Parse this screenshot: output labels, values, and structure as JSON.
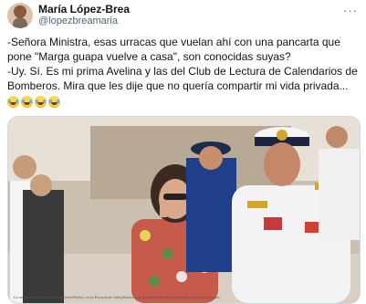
{
  "tweet": {
    "author_name": "María López-Brea",
    "author_handle": "@lopezbreamaria",
    "more_label": "···",
    "text_line1": "-Señora Ministra, esas urracas que vuelan ahí con una pancarta que pone \"Marga guapa vuelve a casa\", son conocidas suyas?",
    "text_line2": "-Uy. Sí. Es mi prima Avelina y las del Club de Lectura de Calendarios de Bomberos. Mira que les dije que no quería compartir mi vida privada..."
  },
  "photo": {
    "caption": "La ministra de Defensa, Margarita Robles, en la Escuela de Suboficiales y de la Armada de San Fernando (Cádiz) este lunes."
  },
  "colors": {
    "text": "#0f1419",
    "secondary": "#536471",
    "border": "#cfd9de"
  }
}
